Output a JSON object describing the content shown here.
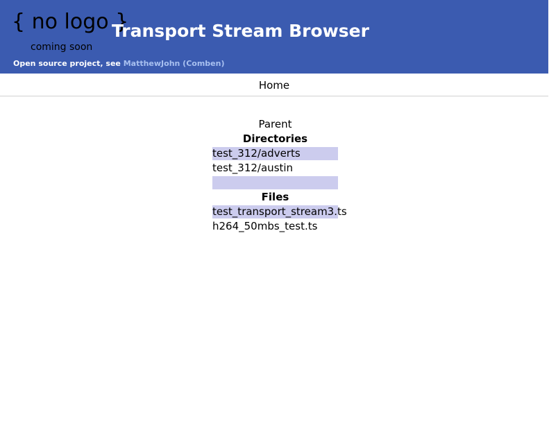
{
  "header": {
    "logo_main": "{ no logo }",
    "logo_sub": "coming soon",
    "title": "Transport Stream Browser",
    "tagline_prefix": "Open source project, see ",
    "tagline_link": "MatthewJohn (Comben)",
    "background_color": "#3b5bb0"
  },
  "nav": {
    "home_label": "Home"
  },
  "browser": {
    "parent_label": "Parent",
    "directories_heading": "Directories",
    "directories": [
      "test_312/adverts",
      "test_312/austin",
      ""
    ],
    "files_heading": "Files",
    "files": [
      "test_transport_stream3.ts",
      "h264_50mbs_test.ts"
    ],
    "highlight_color": "#ccccee"
  }
}
